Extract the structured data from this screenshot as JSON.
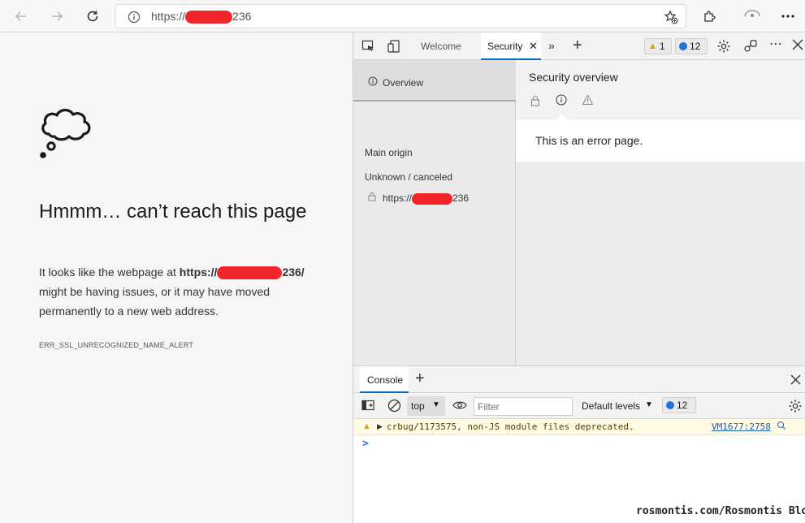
{
  "browser": {
    "address_prefix": "https://",
    "address_suffix": "236"
  },
  "error_page": {
    "title": "Hmmm… can’t reach this page",
    "body_before": "It looks like the webpage at ",
    "url_prefix": "https://",
    "url_suffix": "236/",
    "body_after": " might be having issues, or it may have moved permanently to a new web address.",
    "error_code": "ERR_SSL_UNRECOGNIZED_NAME_ALERT"
  },
  "devtools": {
    "tabs": {
      "welcome": "Welcome",
      "security": "Security"
    },
    "warn_count": "1",
    "msg_count": "12",
    "security": {
      "overview_label": "Overview",
      "main_origin": "Main origin",
      "unknown_canceled": "Unknown / canceled",
      "origin_prefix": "https://",
      "origin_suffix": "236",
      "overview_title": "Security overview",
      "card_text": "This is an error page."
    },
    "console": {
      "tab_label": "Console",
      "context": "top",
      "filter_placeholder": "Filter",
      "levels": "Default levels",
      "badge_count": "12",
      "warning_text": "crbug/1173575, non-JS module files deprecated.",
      "warning_source": "VM1677:2758",
      "prompt": ">"
    }
  },
  "watermark": "rosmontis.com/Rosmontis Blog"
}
